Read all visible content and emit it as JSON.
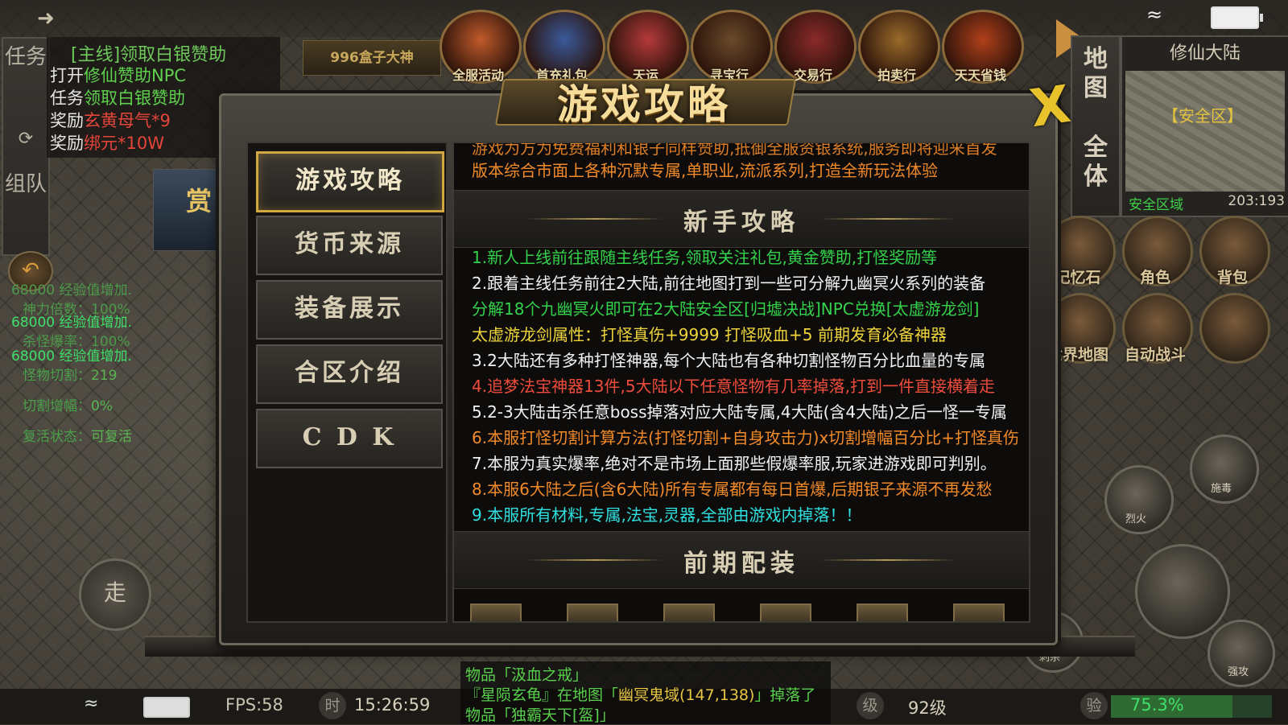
{
  "status": {
    "fps": "FPS:58",
    "time_icon": "时",
    "clock": "15:26:59",
    "level_icon": "级",
    "level": "92级",
    "exp_icon": "验",
    "exp": "75.3%",
    "exp_fraction": 0.753
  },
  "task": {
    "tabs": [
      "任务",
      "组队"
    ],
    "title": "[主线]领取白银赞助",
    "rows": [
      {
        "label": "打开",
        "value": "修仙赞助NPC"
      },
      {
        "label": "任务",
        "value": "领取白银赞助"
      },
      {
        "label": "奖励",
        "value": "玄黄母气*9"
      },
      {
        "label": "奖励",
        "value": "绑元*10W"
      }
    ],
    "box_banner": "996盒子大神",
    "reward_flag": "赏"
  },
  "stats": [
    {
      "text": "68000 经验值增加."
    },
    {
      "text": "神力倍数：100%"
    },
    {
      "text": "68000 经验值增加."
    },
    {
      "text": "杀怪爆率：100%"
    },
    {
      "text": "68000 经验值增加."
    },
    {
      "label": "怪物切割：",
      "value": "219"
    },
    {
      "label": "切割增幅：",
      "value": "0%"
    },
    {
      "label": "复活状态：",
      "value": "可复活"
    }
  ],
  "walk_label": "走",
  "activities": [
    "全服活动",
    "首充礼包",
    "天运",
    "寻宝行",
    "交易行",
    "拍卖行",
    "天天省钱"
  ],
  "activity_colors": [
    "#c05a2a",
    "#3a5a9a",
    "#b43a3a",
    "#6a4a2a",
    "#8a2a2a",
    "#9a6a2a",
    "#b0401a"
  ],
  "map": {
    "tabs": [
      "地图",
      "全体"
    ],
    "title": "修仙大陆",
    "safe": "【安全区】",
    "zone": "安全区域",
    "coord": "203:193"
  },
  "functions": [
    "记忆石",
    "角色",
    "背包",
    "世界地图",
    "自动战斗"
  ],
  "skills": [
    "施毒",
    "烈火",
    "刺杀",
    "强攻"
  ],
  "chat": [
    {
      "parts": [
        {
          "t": "物品「汲血之戒」",
          "c": "g"
        }
      ]
    },
    {
      "parts": [
        {
          "t": "『星陨玄龟』在地图「",
          "c": "g"
        },
        {
          "t": "幽冥鬼域(147,138)",
          "c": "y"
        },
        {
          "t": "」掉落了",
          "c": "g"
        }
      ]
    },
    {
      "parts": [
        {
          "t": "物品「独霸天下[盔]」",
          "c": "g"
        }
      ]
    }
  ],
  "dialog": {
    "title": "游戏攻略",
    "close": "X",
    "menu": [
      "游戏攻略",
      "货币来源",
      "装备展示",
      "合区介绍",
      "C D K"
    ],
    "active_menu": 0,
    "intro_partial": "游戏为方为免费福利和银子同样赞助,抵御全服资银系统,服务即将迎来首发",
    "intro": "版本综合市面上各种沉默专属,单职业,流派系列,打造全新玩法体验",
    "section1": "新手攻略",
    "guide": [
      {
        "text": "1.新人上线前往跟随主线任务,领取关注礼包,黄金赞助,打怪奖励等",
        "color": "green"
      },
      {
        "text": "2.跟着主线任务前往2大陆,前往地图打到一些可分解九幽冥火系列的装备",
        "color": "white"
      },
      {
        "text": "分解18个九幽冥火即可在2大陆安全区[归墟决战]NPC兑换[太虚游龙剑]",
        "color": "green"
      },
      {
        "text": "太虚游龙剑属性：打怪真伤+9999 打怪吸血+5  前期发育必备神器",
        "color": "yellow"
      },
      {
        "text": "3.2大陆还有多种打怪神器,每个大陆也有各种切割怪物百分比血量的专属",
        "color": "white"
      },
      {
        "text": "4.追梦法宝神器13件,5大陆以下任意怪物有几率掉落,打到一件直接横着走",
        "color": "red"
      },
      {
        "text": "5.2-3大陆击杀任意boss掉落对应大陆专属,4大陆(含4大陆)之后一怪一专属",
        "color": "white"
      },
      {
        "text": "6.本服打怪切割计算方法(打怪切割+自身攻击力)x切割增幅百分比+打怪真伤",
        "color": "orange"
      },
      {
        "text": "7.本服为真实爆率,绝对不是市场上面那些假爆率服,玩家进游戏即可判别。",
        "color": "white"
      },
      {
        "text": "8.本服6大陆之后(含6大陆)所有专属都有每日首爆,后期银子来源不再发愁",
        "color": "orange"
      },
      {
        "text": "9.本服所有材料,专属,法宝,灵器,全部由游戏内掉落！！",
        "color": "cyan"
      }
    ],
    "section2": "前期配装",
    "equip_count": 6
  }
}
